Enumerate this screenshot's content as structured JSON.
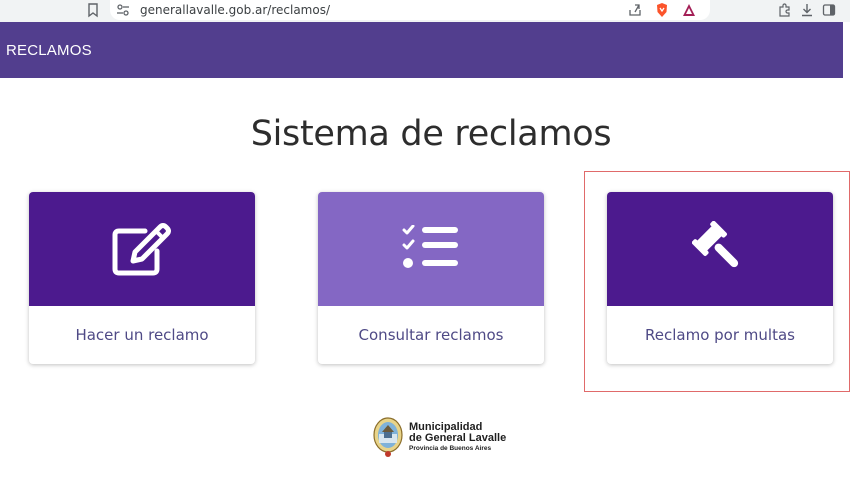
{
  "browser": {
    "url": "generallavalle.gob.ar/reclamos/"
  },
  "header": {
    "brand": "RECLAMOS"
  },
  "main": {
    "title": "Sistema de reclamos",
    "cards": [
      {
        "label": "Hacer un reclamo",
        "icon": "edit-icon",
        "color": "#4c1a8e"
      },
      {
        "label": "Consultar reclamos",
        "icon": "checklist-icon",
        "color": "#8467c4"
      },
      {
        "label": "Reclamo por multas",
        "icon": "gavel-icon",
        "color": "#4c1a8e"
      }
    ]
  },
  "footer": {
    "logo_line1": "Municipalidad",
    "logo_line2": "de General Lavalle",
    "logo_line3": "Provincia de Buenos Aires"
  },
  "colors": {
    "header_bg": "#523e8e",
    "card_dark": "#4c1a8e",
    "card_light": "#8467c4",
    "label_text": "#4f4a86",
    "highlight": "#e06a6a"
  }
}
